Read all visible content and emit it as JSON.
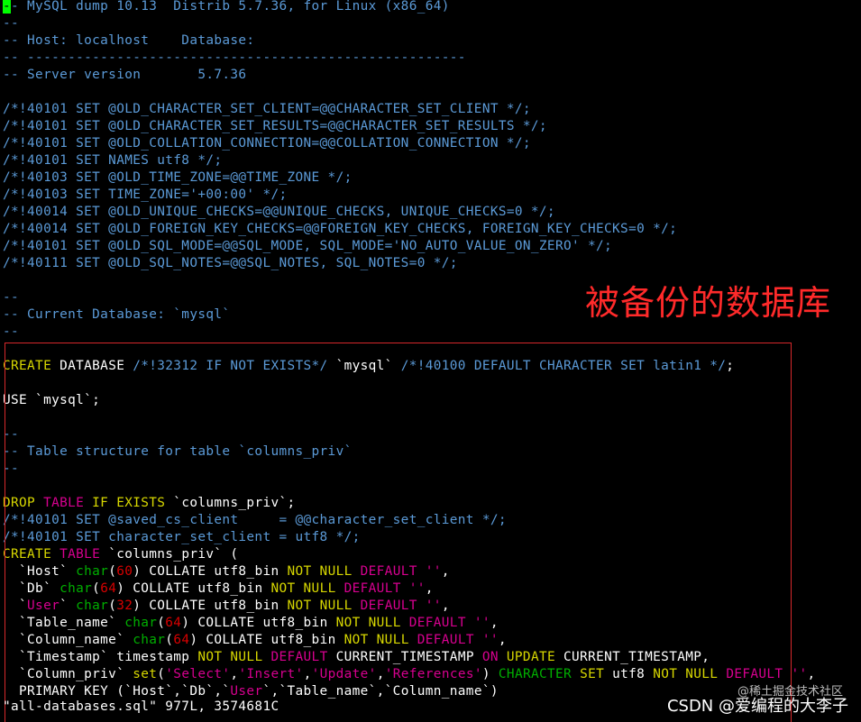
{
  "colors": {
    "comment": "#5b9ad7",
    "plain": "#ffffff",
    "keyword": "#d7d700",
    "keyword_pink": "#d7008f",
    "string": "#d7008f",
    "type": "#00af00",
    "number": "#d70000",
    "cursor": "#00ff00",
    "annotation": "#ff2a2a"
  },
  "lines": [
    [
      {
        "t": "-",
        "c": "cursor"
      },
      {
        "t": "- MySQL dump 10.13  Distrib 5.7.36, for Linux (x86_64)",
        "c": "comment"
      }
    ],
    [
      {
        "t": "--",
        "c": "comment"
      }
    ],
    [
      {
        "t": "-- Host: localhost    Database: ",
        "c": "comment"
      }
    ],
    [
      {
        "t": "-- ------------------------------------------------------",
        "c": "comment"
      }
    ],
    [
      {
        "t": "-- Server version\t5.7.36",
        "c": "comment"
      }
    ],
    [],
    [
      {
        "t": "/*!40101 SET @OLD_CHARACTER_SET_CLIENT=@@CHARACTER_SET_CLIENT */;",
        "c": "comment"
      }
    ],
    [
      {
        "t": "/*!40101 SET @OLD_CHARACTER_SET_RESULTS=@@CHARACTER_SET_RESULTS */;",
        "c": "comment"
      }
    ],
    [
      {
        "t": "/*!40101 SET @OLD_COLLATION_CONNECTION=@@COLLATION_CONNECTION */;",
        "c": "comment"
      }
    ],
    [
      {
        "t": "/*!40101 SET NAMES utf8 */;",
        "c": "comment"
      }
    ],
    [
      {
        "t": "/*!40103 SET @OLD_TIME_ZONE=@@TIME_ZONE */;",
        "c": "comment"
      }
    ],
    [
      {
        "t": "/*!40103 SET TIME_ZONE='+00:00' */;",
        "c": "comment"
      }
    ],
    [
      {
        "t": "/*!40014 SET @OLD_UNIQUE_CHECKS=@@UNIQUE_CHECKS, UNIQUE_CHECKS=0 */;",
        "c": "comment"
      }
    ],
    [
      {
        "t": "/*!40014 SET @OLD_FOREIGN_KEY_CHECKS=@@FOREIGN_KEY_CHECKS, FOREIGN_KEY_CHECKS=0 */;",
        "c": "comment"
      }
    ],
    [
      {
        "t": "/*!40101 SET @OLD_SQL_MODE=@@SQL_MODE, SQL_MODE='NO_AUTO_VALUE_ON_ZERO' */;",
        "c": "comment"
      }
    ],
    [
      {
        "t": "/*!40111 SET @OLD_SQL_NOTES=@@SQL_NOTES, SQL_NOTES=0 */;",
        "c": "comment"
      }
    ],
    [],
    [
      {
        "t": "--",
        "c": "comment"
      }
    ],
    [
      {
        "t": "-- Current Database: `mysql`",
        "c": "comment"
      }
    ],
    [
      {
        "t": "--",
        "c": "comment"
      }
    ],
    [],
    [
      {
        "t": "CREATE",
        "c": "keyword"
      },
      {
        "t": " DATABASE ",
        "c": "plain"
      },
      {
        "t": "/*!32312 IF NOT EXISTS*/",
        "c": "comment"
      },
      {
        "t": " `mysql` ",
        "c": "plain"
      },
      {
        "t": "/*!40100 DEFAULT CHARACTER SET latin1 */",
        "c": "comment"
      },
      {
        "t": ";",
        "c": "plain"
      }
    ],
    [],
    [
      {
        "t": "USE `mysql`;",
        "c": "plain"
      }
    ],
    [],
    [
      {
        "t": "--",
        "c": "comment"
      }
    ],
    [
      {
        "t": "-- Table structure for table `columns_priv`",
        "c": "comment"
      }
    ],
    [
      {
        "t": "--",
        "c": "comment"
      }
    ],
    [],
    [
      {
        "t": "DROP",
        "c": "keyword"
      },
      {
        "t": " ",
        "c": "plain"
      },
      {
        "t": "TABLE",
        "c": "keyword_pink"
      },
      {
        "t": " ",
        "c": "plain"
      },
      {
        "t": "IF EXISTS",
        "c": "keyword"
      },
      {
        "t": " `columns_priv`;",
        "c": "plain"
      }
    ],
    [
      {
        "t": "/*!40101 SET @saved_cs_client     = @@character_set_client */;",
        "c": "comment"
      }
    ],
    [
      {
        "t": "/*!40101 SET character_set_client = utf8 */;",
        "c": "comment"
      }
    ],
    [
      {
        "t": "CREATE",
        "c": "keyword"
      },
      {
        "t": " ",
        "c": "plain"
      },
      {
        "t": "TABLE",
        "c": "keyword_pink"
      },
      {
        "t": " `columns_priv` (",
        "c": "plain"
      }
    ],
    [
      {
        "t": "  `Host` ",
        "c": "plain"
      },
      {
        "t": "char",
        "c": "type"
      },
      {
        "t": "(",
        "c": "plain"
      },
      {
        "t": "60",
        "c": "number"
      },
      {
        "t": ") COLLATE utf8_bin ",
        "c": "plain"
      },
      {
        "t": "NOT NULL",
        "c": "keyword"
      },
      {
        "t": " ",
        "c": "plain"
      },
      {
        "t": "DEFAULT",
        "c": "keyword_pink"
      },
      {
        "t": " ",
        "c": "plain"
      },
      {
        "t": "''",
        "c": "string"
      },
      {
        "t": ",",
        "c": "plain"
      }
    ],
    [
      {
        "t": "  `Db` ",
        "c": "plain"
      },
      {
        "t": "char",
        "c": "type"
      },
      {
        "t": "(",
        "c": "plain"
      },
      {
        "t": "64",
        "c": "number"
      },
      {
        "t": ") COLLATE utf8_bin ",
        "c": "plain"
      },
      {
        "t": "NOT NULL",
        "c": "keyword"
      },
      {
        "t": " ",
        "c": "plain"
      },
      {
        "t": "DEFAULT",
        "c": "keyword_pink"
      },
      {
        "t": " ",
        "c": "plain"
      },
      {
        "t": "''",
        "c": "string"
      },
      {
        "t": ",",
        "c": "plain"
      }
    ],
    [
      {
        "t": "  `",
        "c": "plain"
      },
      {
        "t": "User",
        "c": "keyword_pink"
      },
      {
        "t": "` ",
        "c": "plain"
      },
      {
        "t": "char",
        "c": "type"
      },
      {
        "t": "(",
        "c": "plain"
      },
      {
        "t": "32",
        "c": "number"
      },
      {
        "t": ") COLLATE utf8_bin ",
        "c": "plain"
      },
      {
        "t": "NOT NULL",
        "c": "keyword"
      },
      {
        "t": " ",
        "c": "plain"
      },
      {
        "t": "DEFAULT",
        "c": "keyword_pink"
      },
      {
        "t": " ",
        "c": "plain"
      },
      {
        "t": "''",
        "c": "string"
      },
      {
        "t": ",",
        "c": "plain"
      }
    ],
    [
      {
        "t": "  `Table_name` ",
        "c": "plain"
      },
      {
        "t": "char",
        "c": "type"
      },
      {
        "t": "(",
        "c": "plain"
      },
      {
        "t": "64",
        "c": "number"
      },
      {
        "t": ") COLLATE utf8_bin ",
        "c": "plain"
      },
      {
        "t": "NOT NULL",
        "c": "keyword"
      },
      {
        "t": " ",
        "c": "plain"
      },
      {
        "t": "DEFAULT",
        "c": "keyword_pink"
      },
      {
        "t": " ",
        "c": "plain"
      },
      {
        "t": "''",
        "c": "string"
      },
      {
        "t": ",",
        "c": "plain"
      }
    ],
    [
      {
        "t": "  `Column_name` ",
        "c": "plain"
      },
      {
        "t": "char",
        "c": "type"
      },
      {
        "t": "(",
        "c": "plain"
      },
      {
        "t": "64",
        "c": "number"
      },
      {
        "t": ") COLLATE utf8_bin ",
        "c": "plain"
      },
      {
        "t": "NOT NULL",
        "c": "keyword"
      },
      {
        "t": " ",
        "c": "plain"
      },
      {
        "t": "DEFAULT",
        "c": "keyword_pink"
      },
      {
        "t": " ",
        "c": "plain"
      },
      {
        "t": "''",
        "c": "string"
      },
      {
        "t": ",",
        "c": "plain"
      }
    ],
    [
      {
        "t": "  `Timestamp` timestamp ",
        "c": "plain"
      },
      {
        "t": "NOT NULL",
        "c": "keyword"
      },
      {
        "t": " ",
        "c": "plain"
      },
      {
        "t": "DEFAULT",
        "c": "keyword_pink"
      },
      {
        "t": " CURRENT_TIMESTAMP ",
        "c": "plain"
      },
      {
        "t": "ON",
        "c": "keyword_pink"
      },
      {
        "t": " ",
        "c": "plain"
      },
      {
        "t": "UPDATE",
        "c": "keyword"
      },
      {
        "t": " CURRENT_TIMESTAMP,",
        "c": "plain"
      }
    ],
    [
      {
        "t": "  `Column_priv` ",
        "c": "plain"
      },
      {
        "t": "set",
        "c": "keyword"
      },
      {
        "t": "(",
        "c": "plain"
      },
      {
        "t": "'Select'",
        "c": "string"
      },
      {
        "t": ",",
        "c": "plain"
      },
      {
        "t": "'Insert'",
        "c": "string"
      },
      {
        "t": ",",
        "c": "plain"
      },
      {
        "t": "'Update'",
        "c": "string"
      },
      {
        "t": ",",
        "c": "plain"
      },
      {
        "t": "'References'",
        "c": "string"
      },
      {
        "t": ") ",
        "c": "plain"
      },
      {
        "t": "CHARACTER",
        "c": "type"
      },
      {
        "t": " ",
        "c": "plain"
      },
      {
        "t": "SET",
        "c": "keyword"
      },
      {
        "t": " utf8 ",
        "c": "plain"
      },
      {
        "t": "NOT NULL",
        "c": "keyword"
      },
      {
        "t": " ",
        "c": "plain"
      },
      {
        "t": "DEFAULT",
        "c": "keyword_pink"
      },
      {
        "t": " ",
        "c": "plain"
      },
      {
        "t": "''",
        "c": "string"
      },
      {
        "t": ",",
        "c": "plain"
      }
    ],
    [
      {
        "t": "  PRIMARY KEY (`Host`,`Db`,`",
        "c": "plain"
      },
      {
        "t": "User",
        "c": "keyword_pink"
      },
      {
        "t": "`,`Table_name`,`Column_name`)",
        "c": "plain"
      }
    ]
  ],
  "status_line": "\"all-databases.sql\" 977L, 3574681C",
  "annotation": "被备份的数据库",
  "watermark": {
    "top": "@稀土掘金技术社区",
    "bottom": "CSDN @爱编程的大李子"
  }
}
